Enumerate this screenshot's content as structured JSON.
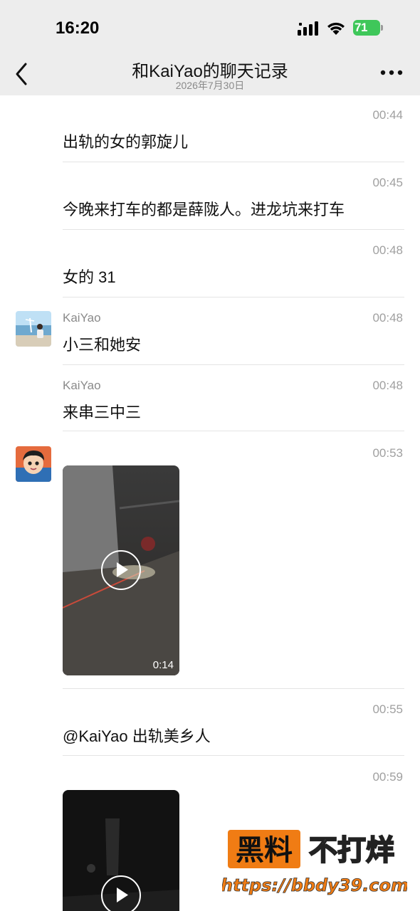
{
  "status_bar": {
    "time": "16:20",
    "battery": "71"
  },
  "header": {
    "title": "和KaiYao的聊天记录",
    "date": "2026年7月30日"
  },
  "messages": [
    {
      "time": "00:44",
      "sender": "",
      "text": "出轨的女的郭旋儿"
    },
    {
      "time": "00:45",
      "sender": "",
      "text": "今晚来打车的都是薛陇人。进龙坑来打车"
    },
    {
      "time": "00:48",
      "sender": "",
      "text": "女的 31"
    },
    {
      "time": "00:48",
      "sender": "KaiYao",
      "text": "小三和她安"
    },
    {
      "time": "00:48",
      "sender": "KaiYao",
      "text": "来串三中三"
    },
    {
      "time": "00:53",
      "sender": "",
      "video_duration": "0:14"
    },
    {
      "time": "00:55",
      "sender": "",
      "text": "@KaiYao 出轨美乡人"
    },
    {
      "time": "00:59",
      "sender": ""
    }
  ],
  "watermark": {
    "brand_left": "黑料",
    "brand_right": "不打烊",
    "url": "https://bbdy39.com"
  }
}
